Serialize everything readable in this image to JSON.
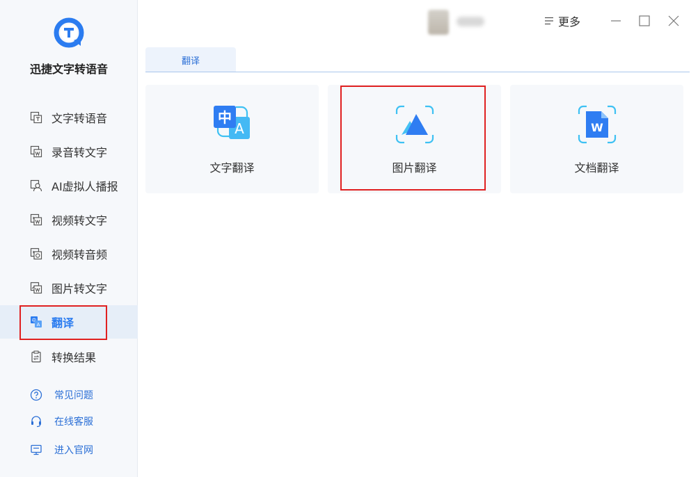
{
  "app": {
    "name": "迅捷文字转语音"
  },
  "sidebar": {
    "items": [
      {
        "label": "文字转语音",
        "icon": "text-to-speech-icon"
      },
      {
        "label": "录音转文字",
        "icon": "recording-to-text-icon"
      },
      {
        "label": "AI虚拟人播报",
        "icon": "ai-avatar-icon"
      },
      {
        "label": "视频转文字",
        "icon": "video-to-text-icon"
      },
      {
        "label": "视频转音频",
        "icon": "video-to-audio-icon"
      },
      {
        "label": "图片转文字",
        "icon": "image-to-text-icon"
      },
      {
        "label": "翻译",
        "icon": "translate-icon",
        "active": true
      },
      {
        "label": "转换结果",
        "icon": "results-icon"
      }
    ],
    "help": [
      {
        "label": "常见问题",
        "icon": "question-icon"
      },
      {
        "label": "在线客服",
        "icon": "headset-icon"
      },
      {
        "label": "进入官网",
        "icon": "monitor-icon"
      }
    ]
  },
  "titlebar": {
    "more_label": "更多"
  },
  "tabs": [
    {
      "label": "翻译",
      "active": true
    }
  ],
  "cards": [
    {
      "label": "文字翻译",
      "icon": "text-translate-icon"
    },
    {
      "label": "图片翻译",
      "icon": "image-translate-icon",
      "highlighted": true
    },
    {
      "label": "文档翻译",
      "icon": "document-translate-icon"
    }
  ],
  "colors": {
    "accent": "#2b7cf0",
    "highlight": "#e02020",
    "sidebar_bg": "#f6f8fb",
    "card_bg": "#f6f8fb"
  }
}
